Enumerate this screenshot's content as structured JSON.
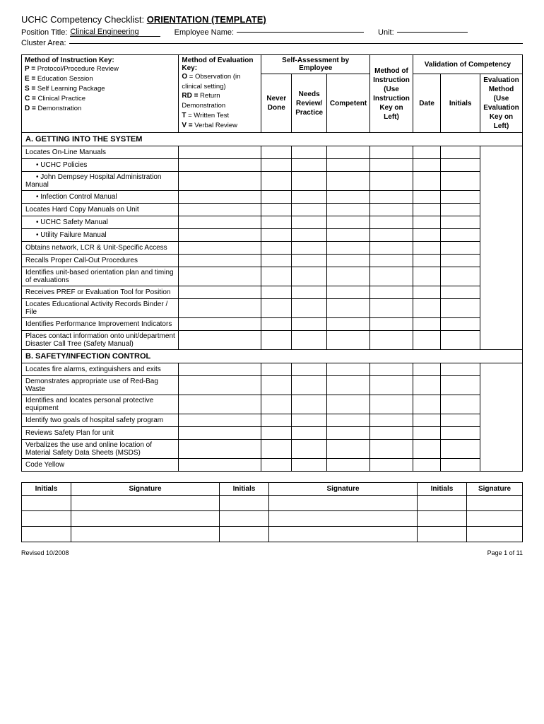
{
  "header": {
    "title_prefix": "UCHC Competency Checklist:",
    "title_value": "ORIENTATION  (TEMPLATE)",
    "position_label": "Position Title:",
    "position_value": "Clinical Engineering",
    "employee_label": "Employee Name:",
    "employee_value": "",
    "unit_label": "Unit:",
    "unit_value": "",
    "cluster_label": "Cluster Area:",
    "cluster_value": ""
  },
  "key_left": {
    "title": "Method of Instruction Key:",
    "items": [
      "P = Protocol/Procedure Review",
      "E = Education Session",
      "S = Self Learning Package",
      "C = Clinical Practice",
      "D =  Demonstration"
    ]
  },
  "key_middle": {
    "title": "Method of Evaluation Key:",
    "items": [
      "O  = Observation (in clinical setting)",
      "RD = Return Demonstration",
      "T  = Written Test",
      "V =  Verbal Review"
    ]
  },
  "self_assessment_label": "Self-Assessment by Employee",
  "validation_label": "Validation of Competency",
  "col_headers": {
    "never_done": "Never Done",
    "needs_review": "Needs Review/ Practice",
    "competent": "Competent",
    "method_instruction": "Method of Instruction (Use Instruction Key on Left)",
    "date": "Date",
    "initials": "Initials",
    "eval_method": "Evaluation Method (Use Evaluation Key on Left)"
  },
  "sections": [
    {
      "id": "A",
      "title": "A.  GETTING INTO THE SYSTEM",
      "rows": [
        {
          "task": "Locates On-Line Manuals",
          "indent": 0
        },
        {
          "task": "UCHC Policies",
          "indent": 1
        },
        {
          "task": "John Dempsey Hospital Administration Manual",
          "indent": 1
        },
        {
          "task": "Infection Control Manual",
          "indent": 1
        },
        {
          "task": "Locates Hard Copy Manuals on Unit",
          "indent": 0
        },
        {
          "task": "UCHC Safety Manual",
          "indent": 1
        },
        {
          "task": "Utility Failure Manual",
          "indent": 1
        },
        {
          "task": "Obtains network, LCR & Unit-Specific Access",
          "indent": 0
        },
        {
          "task": "Recalls Proper Call-Out Procedures",
          "indent": 0
        },
        {
          "task": "Identifies unit-based orientation plan and timing of evaluations",
          "indent": 0
        },
        {
          "task": "Receives PREF or Evaluation Tool for Position",
          "indent": 0
        },
        {
          "task": "Locates Educational Activity Records Binder / File",
          "indent": 0
        },
        {
          "task": "Identifies Performance Improvement Indicators",
          "indent": 0
        },
        {
          "task": "Places contact information onto unit/department Disaster Call Tree (Safety Manual)",
          "indent": 0
        }
      ]
    },
    {
      "id": "B",
      "title": "B.  SAFETY/INFECTION CONTROL",
      "rows": [
        {
          "task": "Locates fire alarms, extinguishers and exits",
          "indent": 0
        },
        {
          "task": "Demonstrates appropriate use of Red-Bag Waste",
          "indent": 0
        },
        {
          "task": "Identifies and locates personal protective equipment",
          "indent": 0
        },
        {
          "task": "Identify two goals of hospital safety program",
          "indent": 0
        },
        {
          "task": "Reviews Safety Plan for unit",
          "indent": 0
        },
        {
          "task": "Verbalizes the use and online location of Material Safety Data Sheets (MSDS)",
          "indent": 0
        },
        {
          "task": "Code Yellow",
          "indent": 0
        }
      ]
    }
  ],
  "signature_table": {
    "headers": [
      "Initials",
      "Signature",
      "Initials",
      "Signature",
      "Initials",
      "Signature"
    ],
    "rows": [
      [
        "",
        "",
        "",
        "",
        "",
        ""
      ],
      [
        "",
        "",
        "",
        "",
        "",
        ""
      ],
      [
        "",
        "",
        "",
        "",
        "",
        ""
      ]
    ]
  },
  "footer": {
    "revised": "Revised 10/2008",
    "page": "Page 1 of 11"
  }
}
